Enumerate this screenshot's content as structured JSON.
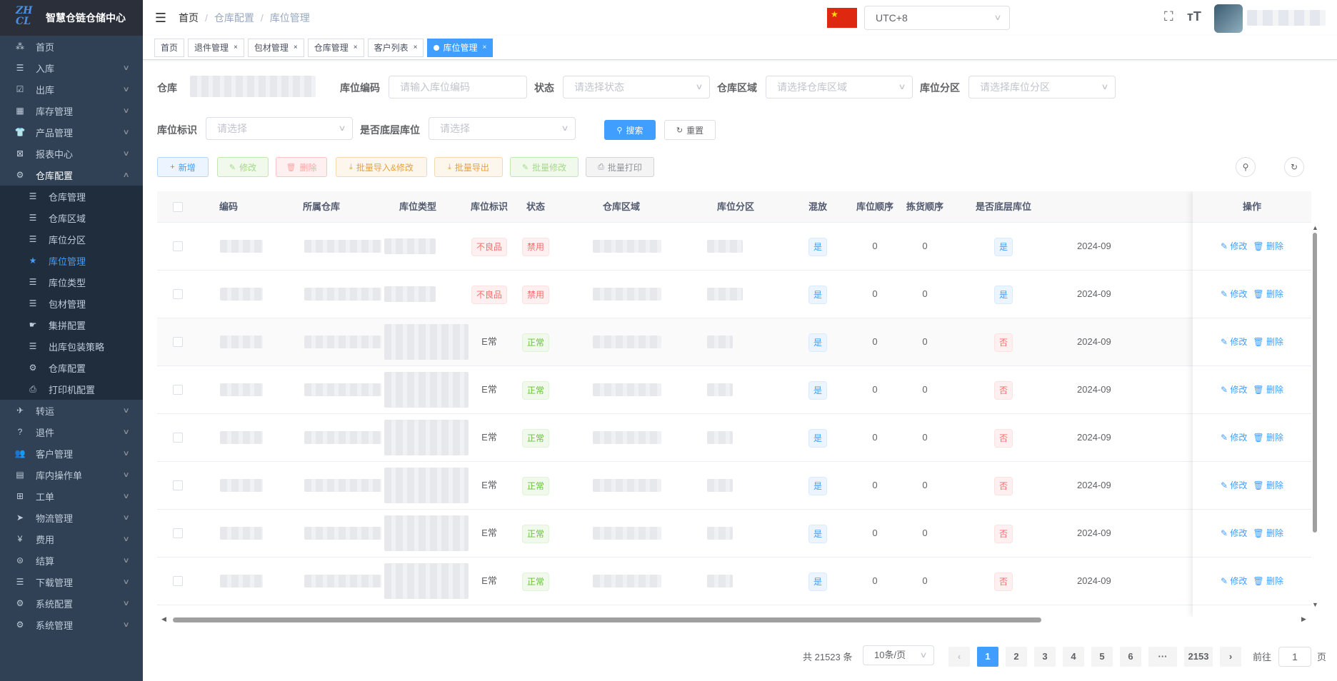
{
  "app": {
    "title": "智慧仓链仓储中心"
  },
  "sidebar": {
    "items": [
      {
        "name": "home",
        "label": "首页",
        "icon": "dashboard-icon",
        "glyph": "⁂",
        "sub": false
      },
      {
        "name": "inbound",
        "label": "入库",
        "icon": "list-icon",
        "glyph": "☰",
        "sub": true
      },
      {
        "name": "outbound",
        "label": "出库",
        "icon": "checkbox-icon",
        "glyph": "☑",
        "sub": true
      },
      {
        "name": "inventory",
        "label": "库存管理",
        "icon": "inventory-icon",
        "glyph": "▦",
        "sub": true
      },
      {
        "name": "product",
        "label": "产品管理",
        "icon": "shirt-icon",
        "glyph": "👕",
        "sub": true
      },
      {
        "name": "report",
        "label": "报表中心",
        "icon": "report-icon",
        "glyph": "⊠",
        "sub": true
      },
      {
        "name": "warehouse-config",
        "label": "仓库配置",
        "icon": "gear-icon",
        "glyph": "⚙",
        "sub": true,
        "open": true
      }
    ],
    "submenu": [
      {
        "name": "warehouse-manage",
        "label": "仓库管理",
        "icon": "list-icon",
        "glyph": "☰"
      },
      {
        "name": "warehouse-area",
        "label": "仓库区域",
        "icon": "list-icon",
        "glyph": "☰"
      },
      {
        "name": "location-zone",
        "label": "库位分区",
        "icon": "list-icon",
        "glyph": "☰"
      },
      {
        "name": "location-manage",
        "label": "库位管理",
        "icon": "star-icon",
        "glyph": "★",
        "active": true
      },
      {
        "name": "location-type",
        "label": "库位类型",
        "icon": "list-icon",
        "glyph": "☰"
      },
      {
        "name": "packing-manage",
        "label": "包材管理",
        "icon": "list-icon",
        "glyph": "☰"
      },
      {
        "name": "consolidation-config",
        "label": "集拼配置",
        "icon": "hand-icon",
        "glyph": "☛"
      },
      {
        "name": "outbound-packing-strategy",
        "label": "出库包装策略",
        "icon": "list-icon",
        "glyph": "☰"
      },
      {
        "name": "warehouse-setting",
        "label": "仓库配置",
        "icon": "gear-icon",
        "glyph": "⚙"
      },
      {
        "name": "printer-config",
        "label": "打印机配置",
        "icon": "printer-icon",
        "glyph": "⎙"
      }
    ],
    "items_after": [
      {
        "name": "transfer",
        "label": "转运",
        "icon": "plane-icon",
        "glyph": "✈"
      },
      {
        "name": "return",
        "label": "退件",
        "icon": "question-icon",
        "glyph": "?"
      },
      {
        "name": "customer",
        "label": "客户管理",
        "icon": "users-icon",
        "glyph": "👥"
      },
      {
        "name": "inner-ops",
        "label": "库内操作单",
        "icon": "doc-icon",
        "glyph": "▤"
      },
      {
        "name": "work-order",
        "label": "工单",
        "icon": "table-icon",
        "glyph": "⊞"
      },
      {
        "name": "logistics",
        "label": "物流管理",
        "icon": "send-icon",
        "glyph": "➤"
      },
      {
        "name": "fee",
        "label": "费用",
        "icon": "yen-icon",
        "glyph": "¥"
      },
      {
        "name": "settlement",
        "label": "结算",
        "icon": "money-icon",
        "glyph": "⊜"
      },
      {
        "name": "download",
        "label": "下载管理",
        "icon": "list-icon",
        "glyph": "☰"
      },
      {
        "name": "sys-config",
        "label": "系统配置",
        "icon": "gear-icon",
        "glyph": "⚙"
      },
      {
        "name": "sys-manage",
        "label": "系统管理",
        "icon": "gear-icon",
        "glyph": "⚙"
      }
    ]
  },
  "navbar": {
    "breadcrumb": [
      "首页",
      "仓库配置",
      "库位管理"
    ],
    "timezone": "UTC+8"
  },
  "tabs": [
    {
      "label": "首页",
      "closable": false
    },
    {
      "label": "退件管理",
      "closable": true
    },
    {
      "label": "包材管理",
      "closable": true
    },
    {
      "label": "仓库管理",
      "closable": true
    },
    {
      "label": "客户列表",
      "closable": true
    },
    {
      "label": "库位管理",
      "closable": true,
      "active": true
    }
  ],
  "filters": {
    "warehouse_label": "仓库",
    "code_label": "库位编码",
    "code_placeholder": "请输入库位编码",
    "status_label": "状态",
    "status_placeholder": "请选择状态",
    "area_label": "仓库区域",
    "area_placeholder": "请选择仓库区域",
    "zone_label": "库位分区",
    "zone_placeholder": "请选择库位分区",
    "mark_label": "库位标识",
    "mark_placeholder": "请选择",
    "bottom_label": "是否底层库位",
    "bottom_placeholder": "请选择",
    "search": "搜索",
    "reset": "重置"
  },
  "toolbar": {
    "add": "新增",
    "edit": "修改",
    "delete": "删除",
    "import": "批量导入&修改",
    "export": "批量导出",
    "batch_edit": "批量修改",
    "print": "批量打印"
  },
  "table": {
    "headers": [
      "编码",
      "所属仓库",
      "库位类型",
      "库位标识",
      "状态",
      "仓库区域",
      "库位分区",
      "混放",
      "库位顺序",
      "拣货顺序",
      "是否底层库位",
      "操作"
    ],
    "op_edit": "修改",
    "op_delete": "删除",
    "rows": [
      {
        "mark": "不良品",
        "mark_type": "danger",
        "status": "禁用",
        "status_type": "danger",
        "mixed": "是",
        "loc_order": "0",
        "pick_order": "0",
        "bottom": "是",
        "bottom_type": "primary",
        "date": "2024-09"
      },
      {
        "mark": "不良品",
        "mark_type": "danger",
        "status": "禁用",
        "status_type": "danger",
        "mixed": "是",
        "loc_order": "0",
        "pick_order": "0",
        "bottom": "是",
        "bottom_type": "primary",
        "date": "2024-09"
      },
      {
        "mark": "E常",
        "mark_type": "plain",
        "status": "正常",
        "status_type": "success",
        "mixed": "是",
        "loc_order": "0",
        "pick_order": "0",
        "bottom": "否",
        "bottom_type": "danger",
        "date": "2024-09"
      },
      {
        "mark": "E常",
        "mark_type": "plain",
        "status": "正常",
        "status_type": "success",
        "mixed": "是",
        "loc_order": "0",
        "pick_order": "0",
        "bottom": "否",
        "bottom_type": "danger",
        "date": "2024-09"
      },
      {
        "mark": "E常",
        "mark_type": "plain",
        "status": "正常",
        "status_type": "success",
        "mixed": "是",
        "loc_order": "0",
        "pick_order": "0",
        "bottom": "否",
        "bottom_type": "danger",
        "date": "2024-09"
      },
      {
        "mark": "E常",
        "mark_type": "plain",
        "status": "正常",
        "status_type": "success",
        "mixed": "是",
        "loc_order": "0",
        "pick_order": "0",
        "bottom": "否",
        "bottom_type": "danger",
        "date": "2024-09"
      },
      {
        "mark": "E常",
        "mark_type": "plain",
        "status": "正常",
        "status_type": "success",
        "mixed": "是",
        "loc_order": "0",
        "pick_order": "0",
        "bottom": "否",
        "bottom_type": "danger",
        "date": "2024-09"
      },
      {
        "mark": "E常",
        "mark_type": "plain",
        "status": "正常",
        "status_type": "success",
        "mixed": "是",
        "loc_order": "0",
        "pick_order": "0",
        "bottom": "否",
        "bottom_type": "danger",
        "date": "2024-09"
      }
    ]
  },
  "pagination": {
    "total_text": "共 21523 条",
    "page_size": "10条/页",
    "pages": [
      "1",
      "2",
      "3",
      "4",
      "5",
      "6"
    ],
    "more": "···",
    "last": "2153",
    "current": "1",
    "goto_label": "前往",
    "goto_value": "1",
    "goto_suffix": "页"
  },
  "colors": {
    "primary": "#409eff",
    "sidebar_bg": "#304156",
    "danger": "#f56c6c",
    "success": "#67c23a"
  }
}
